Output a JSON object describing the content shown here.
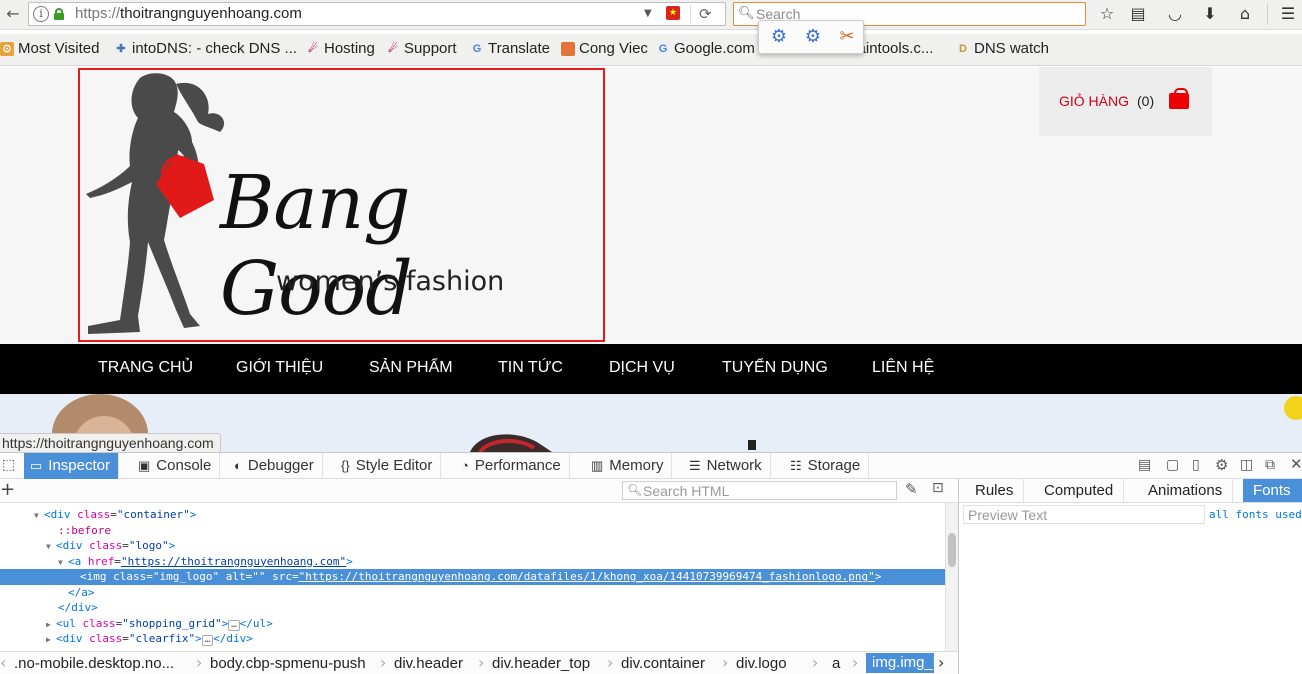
{
  "toolbar": {
    "url_scheme": "https://",
    "url_domain": "thoitrangnguyenhoang.com",
    "search_placeholder": "Search",
    "flag_glyph": "★"
  },
  "bookmarks": [
    {
      "label": "Most Visited",
      "icon": "rss-icon",
      "color": "#e8a23b"
    },
    {
      "label": "intoDNS: - check DNS ...",
      "icon": "puzzle-icon",
      "color": "#4a73c7"
    },
    {
      "label": "Hosting",
      "icon": "hosting-icon",
      "color": "#c2185b"
    },
    {
      "label": "Support",
      "icon": "support-icon",
      "color": "#c2185b"
    },
    {
      "label": "Translate",
      "icon": "google-icon",
      "color": "#4285f4"
    },
    {
      "label": "Cong Viec",
      "icon": "folder-icon",
      "color": "#e2733a"
    },
    {
      "label": "Google.com",
      "icon": "google-icon",
      "color": "#4285f4"
    },
    {
      "label": "whoisdomaintools.c...",
      "icon": "puzzle-icon",
      "color": "#777777"
    },
    {
      "label": "DNS watch",
      "icon": "d-icon",
      "color": "#c8952b"
    }
  ],
  "page": {
    "brand": "Bang Good",
    "tagline": "women’s fashion",
    "cart_label": "GIỎ HÀNG",
    "cart_count": "(0)",
    "nav": [
      "TRANG CHỦ",
      "GIỚI THIỆU",
      "SẢN PHẨM",
      "TIN TỨC",
      "DỊCH VỤ",
      "TUYỂN DỤNG",
      "LIÊN HỆ"
    ],
    "status_url": "https://thoitrangnguyenhoang.com"
  },
  "devtools": {
    "tabs": [
      "Inspector",
      "Console",
      "Debugger",
      "Style Editor",
      "Performance",
      "Memory",
      "Network",
      "Storage"
    ],
    "search_placeholder": "Search HTML",
    "markup": [
      {
        "open": "<div",
        "attrs": [
          [
            "class",
            "\"container\""
          ]
        ],
        "close": ">"
      },
      {
        "pseudo": "::before"
      },
      {
        "open": "<div",
        "attrs": [
          [
            "class",
            "\"logo\""
          ]
        ],
        "close": ">"
      },
      {
        "open": "<a",
        "attrs": [
          [
            "href",
            "\"https://thoitrangnguyenhoang.com\""
          ]
        ],
        "close": ">"
      },
      {
        "open": "<img",
        "attrs": [
          [
            "class",
            "\"img_logo\""
          ],
          [
            "alt",
            "\"\""
          ],
          [
            "src",
            "\"https://thoitrangnguyenhoang.com/datafiles/1/khong_xoa/14410739969474_fashionlogo.png\""
          ]
        ],
        "close": ">"
      },
      {
        "open": "</a>"
      },
      {
        "open": "</div>"
      },
      {
        "open": "<ul",
        "attrs": [
          [
            "class",
            "\"shopping_grid\""
          ]
        ],
        "close": ">",
        "tail": "</ul>"
      },
      {
        "open": "<div",
        "attrs": [
          [
            "class",
            "\"clearfix\""
          ]
        ],
        "close": ">",
        "tail": "</div>"
      }
    ],
    "breadcrumbs": [
      ".no-mobile.desktop.no...",
      "body.cbp-spmenu-push",
      "div.header",
      "div.header_top",
      "div.container",
      "div.logo",
      "a",
      "img.img_logo"
    ],
    "side_tabs": [
      "Rules",
      "Computed",
      "Animations",
      "Fonts"
    ],
    "preview_placeholder": "Preview Text",
    "all_fonts": "all fonts used"
  },
  "colors": {
    "accent": "#4a90d9",
    "logo_border": "#e21b1b",
    "cart_red": "#d0021b",
    "nav_bg": "#000000"
  }
}
